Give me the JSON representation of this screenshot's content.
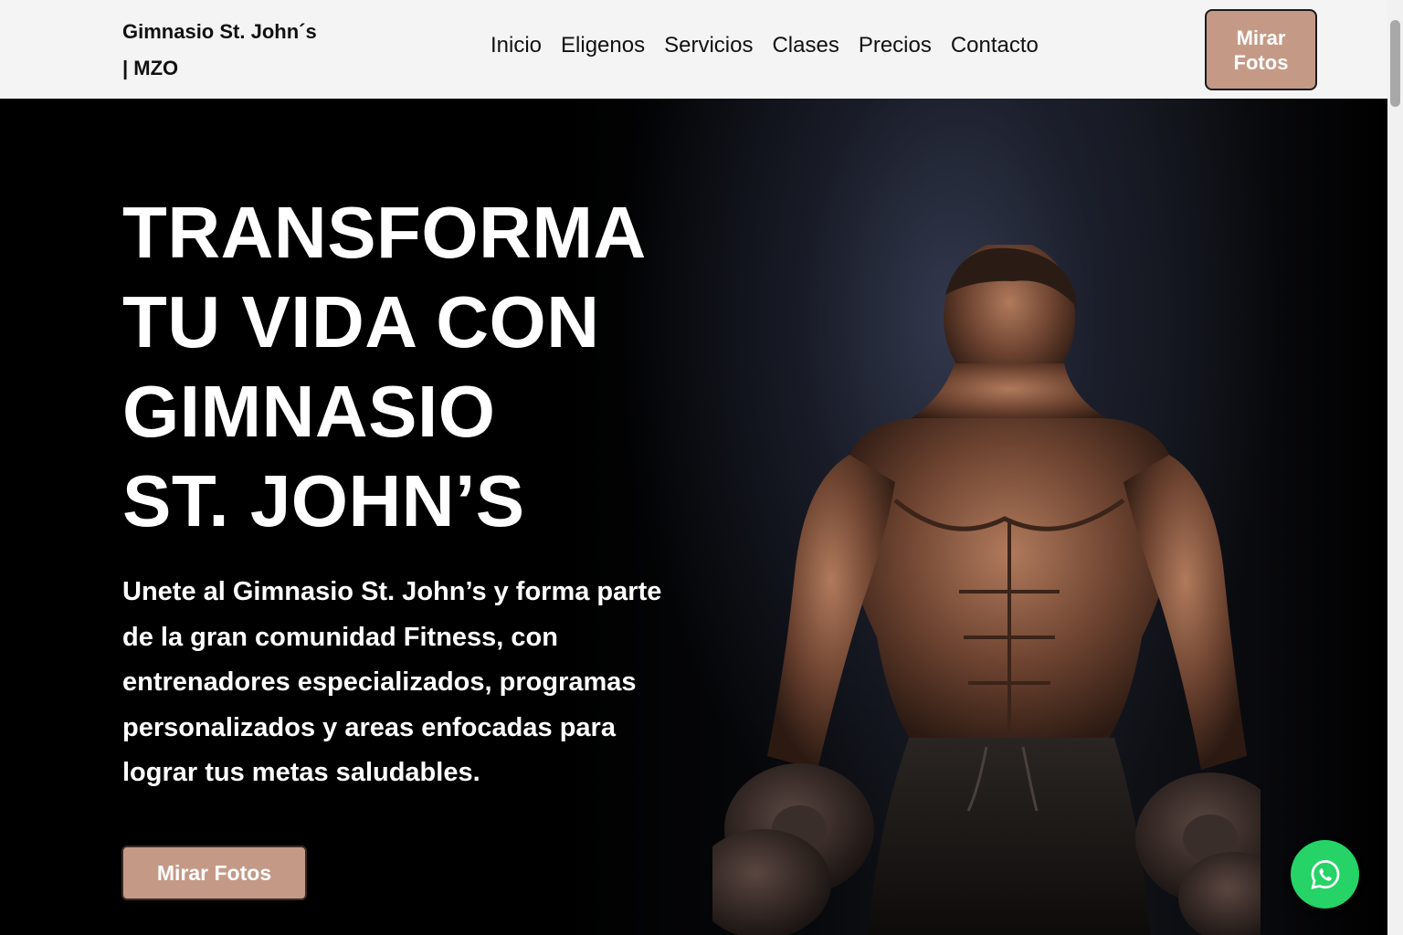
{
  "header": {
    "brand_line1": "Gimnasio St. John´s",
    "brand_line2": "| MZO",
    "nav": [
      {
        "label": "Inicio"
      },
      {
        "label": "Eligenos"
      },
      {
        "label": "Servicios"
      },
      {
        "label": "Clases"
      },
      {
        "label": "Precios"
      },
      {
        "label": "Contacto"
      }
    ],
    "cta_label": "Mirar Fotos"
  },
  "hero": {
    "title_lines": [
      "TRANSFORMA",
      "TU VIDA CON",
      "GIMNASIO",
      "ST. JOHN’S"
    ],
    "description": "Unete al Gimnasio St. John’s y forma parte de la gran comunidad Fitness, con entrenadores especializados, programas personalizados y areas enfocadas para lograr tus metas saludables.",
    "cta_label": "Mirar Fotos",
    "image_icon": "athlete-with-dumbbells-image"
  },
  "floating": {
    "whatsapp_icon": "whatsapp-icon"
  },
  "colors": {
    "accent": "#c49a86",
    "navbar_bg": "#f4f4f4",
    "hero_bg": "#000000",
    "whatsapp": "#25d366"
  }
}
